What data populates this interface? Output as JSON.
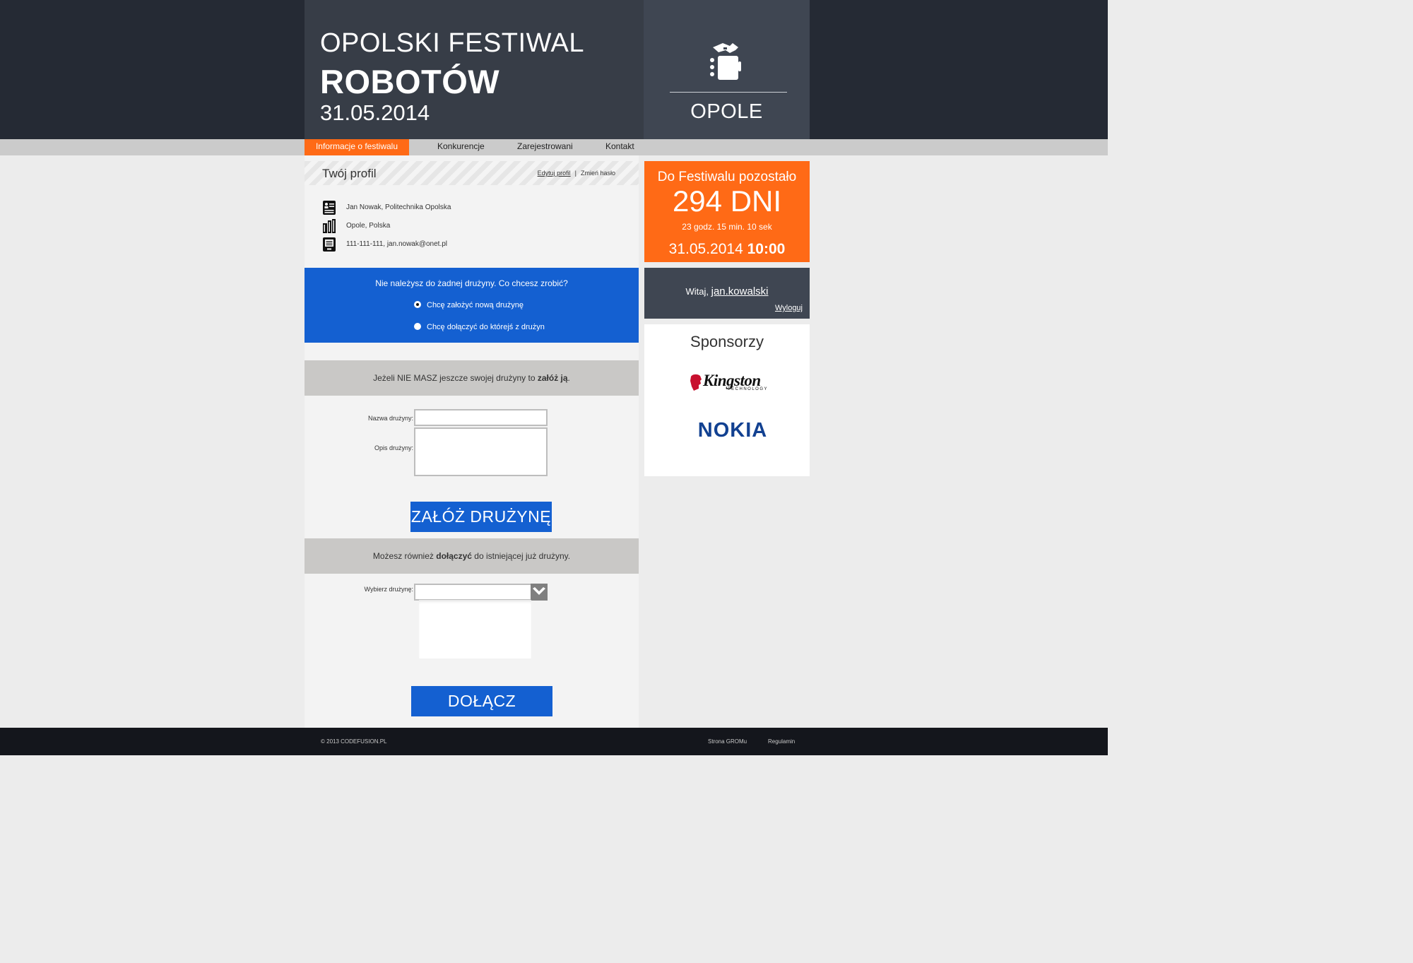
{
  "header": {
    "title_line1": "OPOLSKI FESTIWAL",
    "title_line2": "ROBOTÓW",
    "date": "31.05.2014",
    "city": "OPOLE"
  },
  "nav": {
    "items": [
      {
        "label": "Informacje o festiwalu",
        "active": true
      },
      {
        "label": "Konkurencje",
        "active": false
      },
      {
        "label": "Zarejestrowani",
        "active": false
      },
      {
        "label": "Kontakt",
        "active": false
      }
    ]
  },
  "profile": {
    "title": "Twój profil",
    "edit_link": "Edytuj profil",
    "separator": "|",
    "password_link": "Zmień hasło",
    "rows": [
      {
        "icon": "id-card-icon",
        "text": "Jan Nowak, Politechnika Opolska"
      },
      {
        "icon": "building-icon",
        "text": "Opole, Polska"
      },
      {
        "icon": "contact-device-icon",
        "text": "111-111-111, jan.nowak@onet.pl"
      }
    ]
  },
  "team_choice": {
    "question": "Nie należysz do żadnej drużyny. Co chcesz zrobić?",
    "options": [
      {
        "label": "Chcę założyć nową drużynę",
        "selected": true
      },
      {
        "label": "Chcę dołączyć do którejś z drużyn",
        "selected": false
      }
    ]
  },
  "create_team": {
    "intro_prefix": "Jeżeli NIE MASZ jeszcze swojej drużyny to ",
    "intro_bold": "załóż ją",
    "intro_suffix": ".",
    "name_label": "Nazwa drużyny:",
    "name_value": "",
    "desc_label": "Opis drużyny:",
    "desc_value": "",
    "button": "ZAŁÓŻ DRUŻYNĘ"
  },
  "join_team": {
    "intro_prefix": "Możesz również ",
    "intro_bold": "dołączyć",
    "intro_suffix": " do istniejącej już drużyny.",
    "select_label": "Wybierz drużynę:",
    "select_value": "",
    "button": "DOŁĄCZ"
  },
  "countdown": {
    "label": "Do Festiwalu pozostało",
    "days": "294 DNI",
    "time": "23 godz. 15 min. 10 sek",
    "date": "31.05.2014",
    "hour": "10:00"
  },
  "user": {
    "greeting": "Witaj, ",
    "username": "jan.kowalski",
    "logout": "Wyloguj"
  },
  "sponsors": {
    "title": "Sponsorzy",
    "logos": [
      {
        "name": "Kingston",
        "sub": "TECHNOLOGY"
      },
      {
        "name": "NOKIA"
      }
    ]
  },
  "footer": {
    "copyright": "© 2013 CODEFUSION.PL",
    "link1": "Strona GROMu",
    "link2": "Regulamin"
  },
  "colors": {
    "accent_orange": "#ff6a16",
    "accent_blue": "#1460d1",
    "header_dark": "#373d47",
    "nokia_blue": "#124191",
    "kingston_red": "#c8102e"
  }
}
